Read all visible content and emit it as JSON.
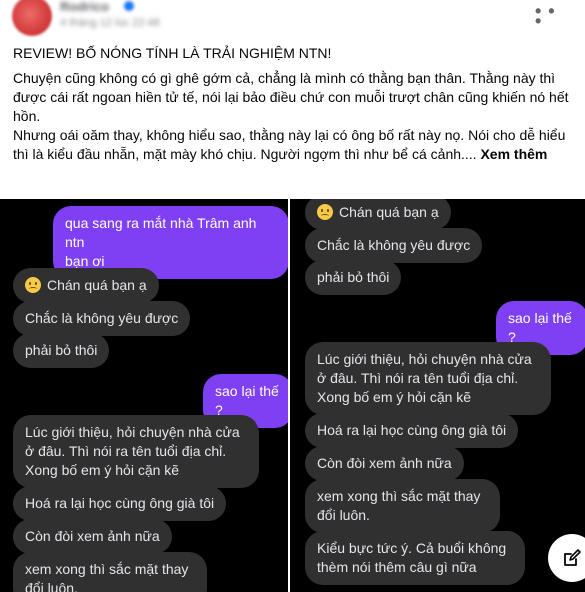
{
  "post": {
    "author_name": "Rodrico",
    "timestamp": "4 tháng 12 lúc 22:48",
    "title": "REVIEW! BỐ NÓNG TÍNH LÀ TRẢI NGHIỆM NTN!",
    "body_lines": [
      "Chuyện cũng không có gì ghê gớm cả, chẳng là mình có thằng bạn thân. Thằng này thì được cái rất ngoan hiền tử tế, nói lại bảo điều chứ con muỗi trượt chân cũng khiến nó hết hồn.",
      "Nhưng oái oăm thay, không hiểu sao, thằng này lại có ông bố rất này nọ. Nói cho dễ hiểu thì là kiểu đầu nhẵn, mặt mày khó chịu. Người ngợm thì như bể cá cảnh....  "
    ],
    "see_more": "Xem thêm",
    "more_icon": "more-horizontal-icon"
  },
  "chat_left": [
    {
      "text": "qua sang ra mắt nhà Trâm anh ntn\nbạn ơi",
      "sender": "me"
    },
    {
      "text": "Chán quá bạn ạ",
      "sender": "friend",
      "emoji": "sad-face-emoji"
    },
    {
      "text": "Chắc là không yêu được",
      "sender": "friend"
    },
    {
      "text": "phải bỏ thôi",
      "sender": "friend"
    },
    {
      "text": "sao lại thế ?",
      "sender": "me"
    },
    {
      "text": "Lúc giới thiệu, hỏi chuyện nhà cửa\nở đâu. Thì nói ra tên tuổi địa chỉ.\nXong bố em ý hỏi cặn kẽ",
      "sender": "friend"
    },
    {
      "text": "Hoá ra lại học cùng ông già tôi",
      "sender": "friend"
    },
    {
      "text": "Còn đòi xem ảnh nữa",
      "sender": "friend"
    },
    {
      "text": "xem xong thì sắc mặt thay\nđổi luôn.",
      "sender": "friend"
    }
  ],
  "chat_right": [
    {
      "text": "Chán quá bạn ạ",
      "sender": "friend",
      "emoji": "sad-face-emoji"
    },
    {
      "text": "Chắc là không yêu được",
      "sender": "friend"
    },
    {
      "text": "phải bỏ thôi",
      "sender": "friend"
    },
    {
      "text": "sao lại thế ?",
      "sender": "me"
    },
    {
      "text": "Lúc giới thiệu, hỏi chuyện nhà cửa\nở đâu. Thì nói ra tên tuổi địa chỉ.\nXong bố em ý hỏi cặn kẽ",
      "sender": "friend"
    },
    {
      "text": "Hoá ra lại học cùng ông già tôi",
      "sender": "friend"
    },
    {
      "text": "Còn đòi xem ảnh nữa",
      "sender": "friend"
    },
    {
      "text": "xem xong thì sắc mặt thay\nđổi luôn.",
      "sender": "friend"
    },
    {
      "text": "Kiểu bực tức ý. Cả buổi không\nthèm nói thêm câu gì nữa",
      "sender": "friend"
    }
  ],
  "colors": {
    "outgoing_bubble": "#7f3ff2",
    "incoming_bubble": "#303030",
    "chat_background": "#000000"
  },
  "compose_icon": "compose-edit-icon"
}
